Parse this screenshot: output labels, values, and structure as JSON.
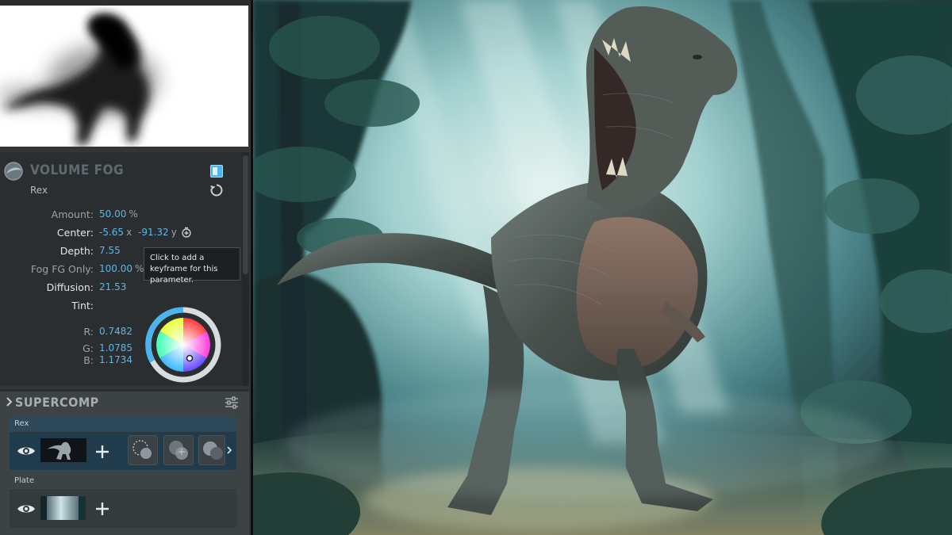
{
  "volume_fog": {
    "title": "VOLUME FOG",
    "subtitle": "Rex",
    "params": {
      "amount": {
        "label": "Amount:",
        "value": "50.00",
        "unit": "%"
      },
      "center": {
        "label": "Center:",
        "x": "-5.65",
        "x_unit": "x",
        "y": "-91.32",
        "y_unit": "y"
      },
      "depth": {
        "label": "Depth:",
        "value": "7.55"
      },
      "fog_fg_only": {
        "label": "Fog FG Only:",
        "value": "100.00",
        "unit": "%"
      },
      "diffusion": {
        "label": "Diffusion:",
        "value": "21.53"
      },
      "tint": {
        "label": "Tint:"
      },
      "r": {
        "label": "R:",
        "value": "0.7482"
      },
      "g": {
        "label": "G:",
        "value": "1.0785"
      },
      "b": {
        "label": "B:",
        "value": "1.1734"
      }
    },
    "tooltip": "Click to add a keyframe for this parameter.",
    "accent_color": "#4ab4ee",
    "icons": [
      "volume-fog-logo-icon",
      "toggle-icon",
      "reset-icon",
      "keyframe-icon"
    ]
  },
  "supercomp": {
    "title": "SUPERCOMP",
    "layers": [
      {
        "name": "Rex",
        "effects": [
          "light-wrap-icon",
          "fog-blend-icon",
          "shadow-blend-icon"
        ]
      },
      {
        "name": "Plate"
      }
    ],
    "icons": [
      "expand-arrow-icon",
      "settings-sliders-icon",
      "eye-icon",
      "add-icon",
      "more-arrow-icon"
    ]
  }
}
